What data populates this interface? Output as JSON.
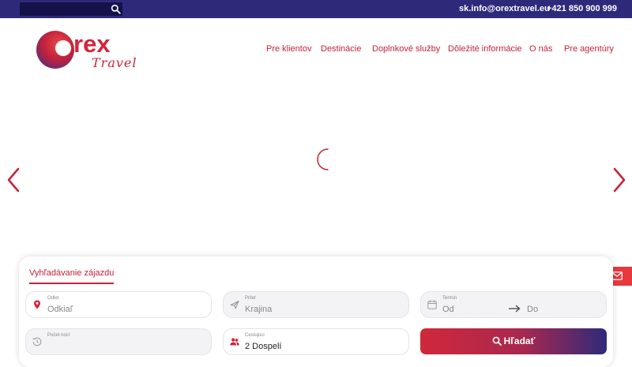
{
  "topbar": {
    "search_placeholder": "",
    "email": "sk.info@orextravel.eu",
    "phone": "+421 850 900 999"
  },
  "logo": {
    "brand_main": "rex",
    "brand_sub": "Travel"
  },
  "nav": {
    "items": [
      "Pre klientov",
      "Destinácie",
      "Doplnkové služby",
      "Dôležité informácie",
      "O nás",
      "Pre agentúry"
    ]
  },
  "search": {
    "tab_label": "Vyhľadávanie zájazdu",
    "from": {
      "label": "Odlet",
      "placeholder": "Odkiaľ"
    },
    "to": {
      "label": "Prilet",
      "placeholder": "Krajina"
    },
    "term": {
      "label": "Termín",
      "from_placeholder": "Od",
      "to_placeholder": "Do"
    },
    "nights": {
      "label": "Počet nocí",
      "value": ""
    },
    "travelers": {
      "label": "Cestujúci",
      "value": "2 Dospelí"
    },
    "button_label": "Hľadať"
  },
  "colors": {
    "brand_red": "#c4233a",
    "brand_navy": "#2e2a7a",
    "mail_tab": "#e8383d"
  },
  "icons": [
    "search-icon",
    "arrow-left-icon",
    "arrow-right-icon",
    "loading-spinner-icon",
    "location-pin-icon",
    "plane-icon",
    "calendar-icon",
    "arrow-right-small-icon",
    "clock-history-icon",
    "users-icon",
    "mail-icon"
  ]
}
